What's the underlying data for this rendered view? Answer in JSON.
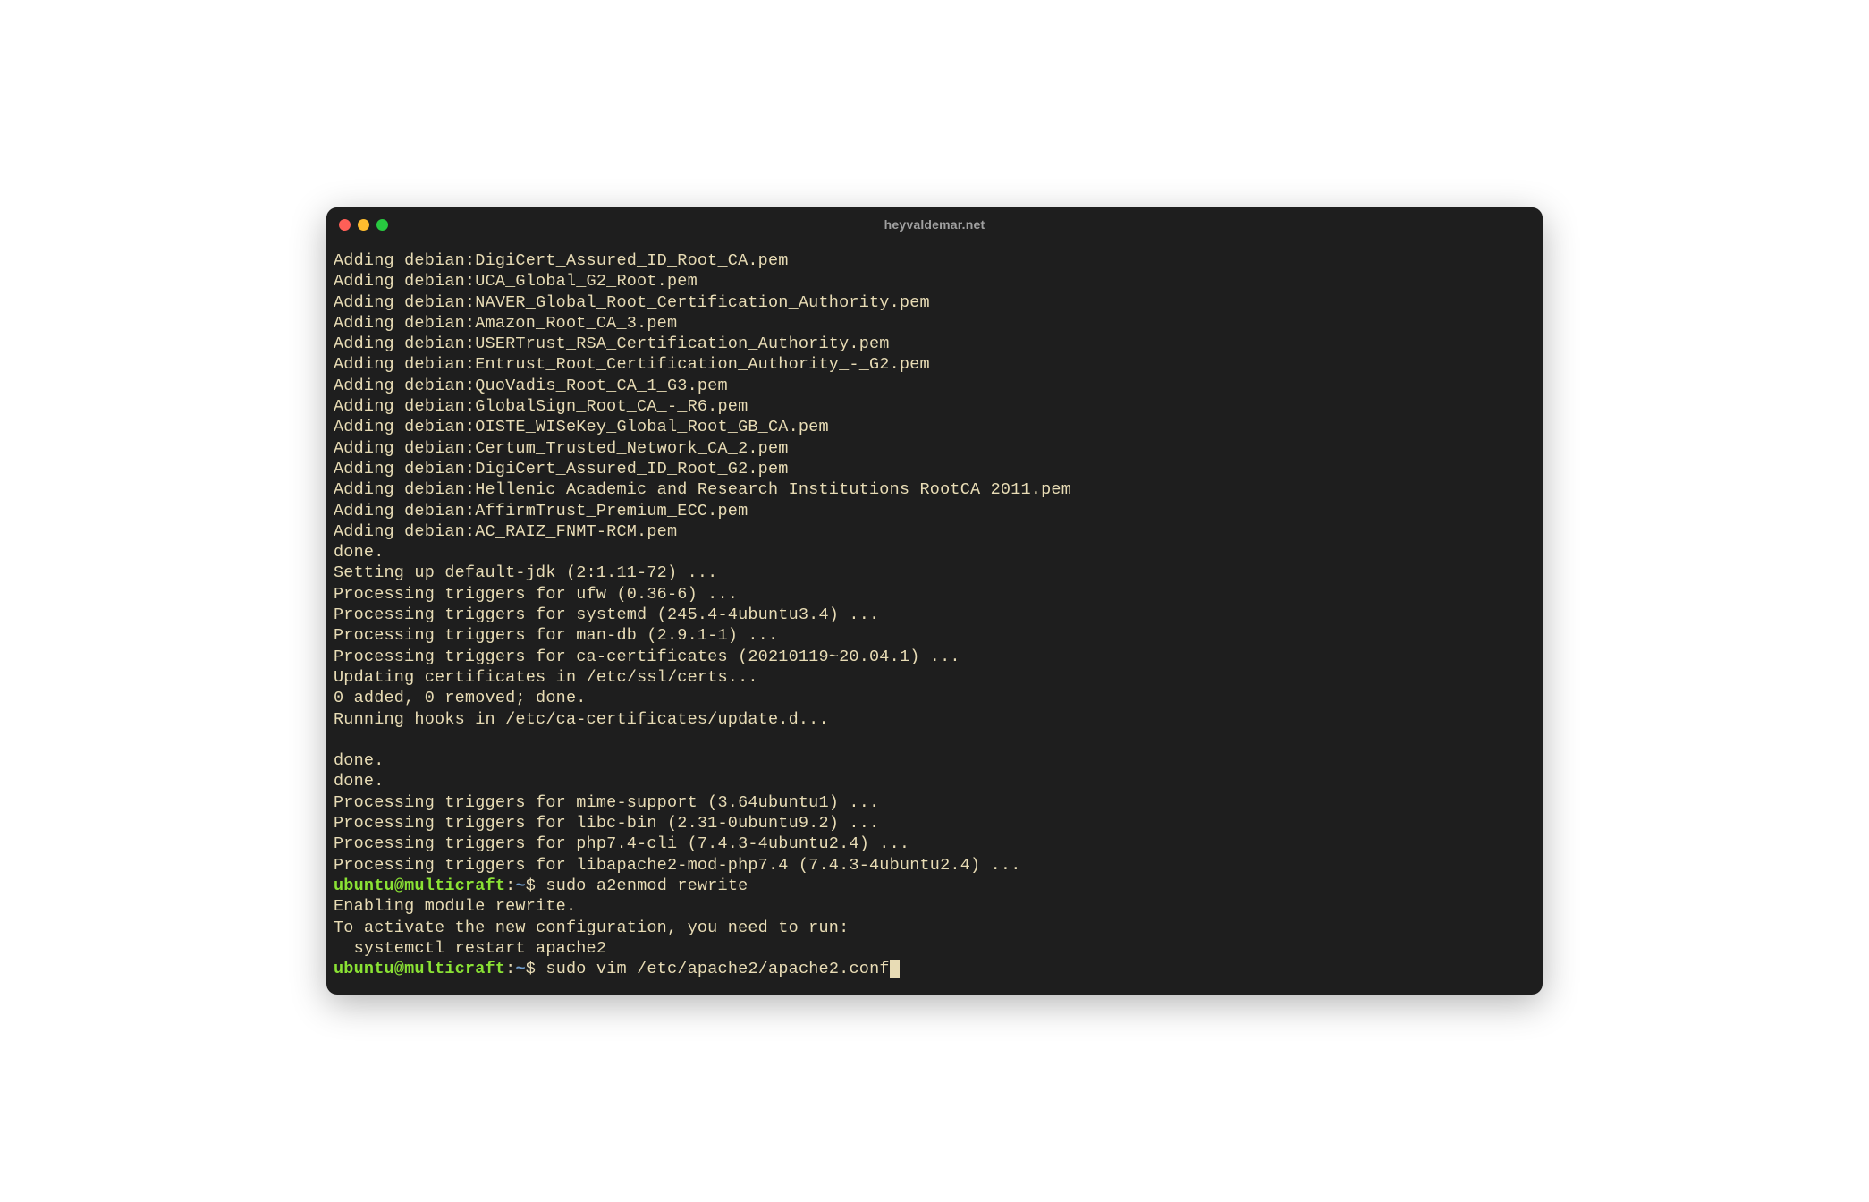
{
  "window": {
    "title": "heyvaldemar.net"
  },
  "prompt": {
    "user": "ubuntu",
    "host": "multicraft",
    "sep_at": "@",
    "sep_colon": ":",
    "path": "~",
    "dollar": "$"
  },
  "output": {
    "lines": [
      "Adding debian:DigiCert_Assured_ID_Root_CA.pem",
      "Adding debian:UCA_Global_G2_Root.pem",
      "Adding debian:NAVER_Global_Root_Certification_Authority.pem",
      "Adding debian:Amazon_Root_CA_3.pem",
      "Adding debian:USERTrust_RSA_Certification_Authority.pem",
      "Adding debian:Entrust_Root_Certification_Authority_-_G2.pem",
      "Adding debian:QuoVadis_Root_CA_1_G3.pem",
      "Adding debian:GlobalSign_Root_CA_-_R6.pem",
      "Adding debian:OISTE_WISeKey_Global_Root_GB_CA.pem",
      "Adding debian:Certum_Trusted_Network_CA_2.pem",
      "Adding debian:DigiCert_Assured_ID_Root_G2.pem",
      "Adding debian:Hellenic_Academic_and_Research_Institutions_RootCA_2011.pem",
      "Adding debian:AffirmTrust_Premium_ECC.pem",
      "Adding debian:AC_RAIZ_FNMT-RCM.pem",
      "done.",
      "Setting up default-jdk (2:1.11-72) ...",
      "Processing triggers for ufw (0.36-6) ...",
      "Processing triggers for systemd (245.4-4ubuntu3.4) ...",
      "Processing triggers for man-db (2.9.1-1) ...",
      "Processing triggers for ca-certificates (20210119~20.04.1) ...",
      "Updating certificates in /etc/ssl/certs...",
      "0 added, 0 removed; done.",
      "Running hooks in /etc/ca-certificates/update.d...",
      "",
      "done.",
      "done.",
      "Processing triggers for mime-support (3.64ubuntu1) ...",
      "Processing triggers for libc-bin (2.31-0ubuntu9.2) ...",
      "Processing triggers for php7.4-cli (7.4.3-4ubuntu2.4) ...",
      "Processing triggers for libapache2-mod-php7.4 (7.4.3-4ubuntu2.4) ..."
    ]
  },
  "commands": {
    "first": "sudo a2enmod rewrite",
    "first_output": [
      "Enabling module rewrite.",
      "To activate the new configuration, you need to run:",
      "  systemctl restart apache2"
    ],
    "current": "sudo vim /etc/apache2/apache2.conf"
  }
}
